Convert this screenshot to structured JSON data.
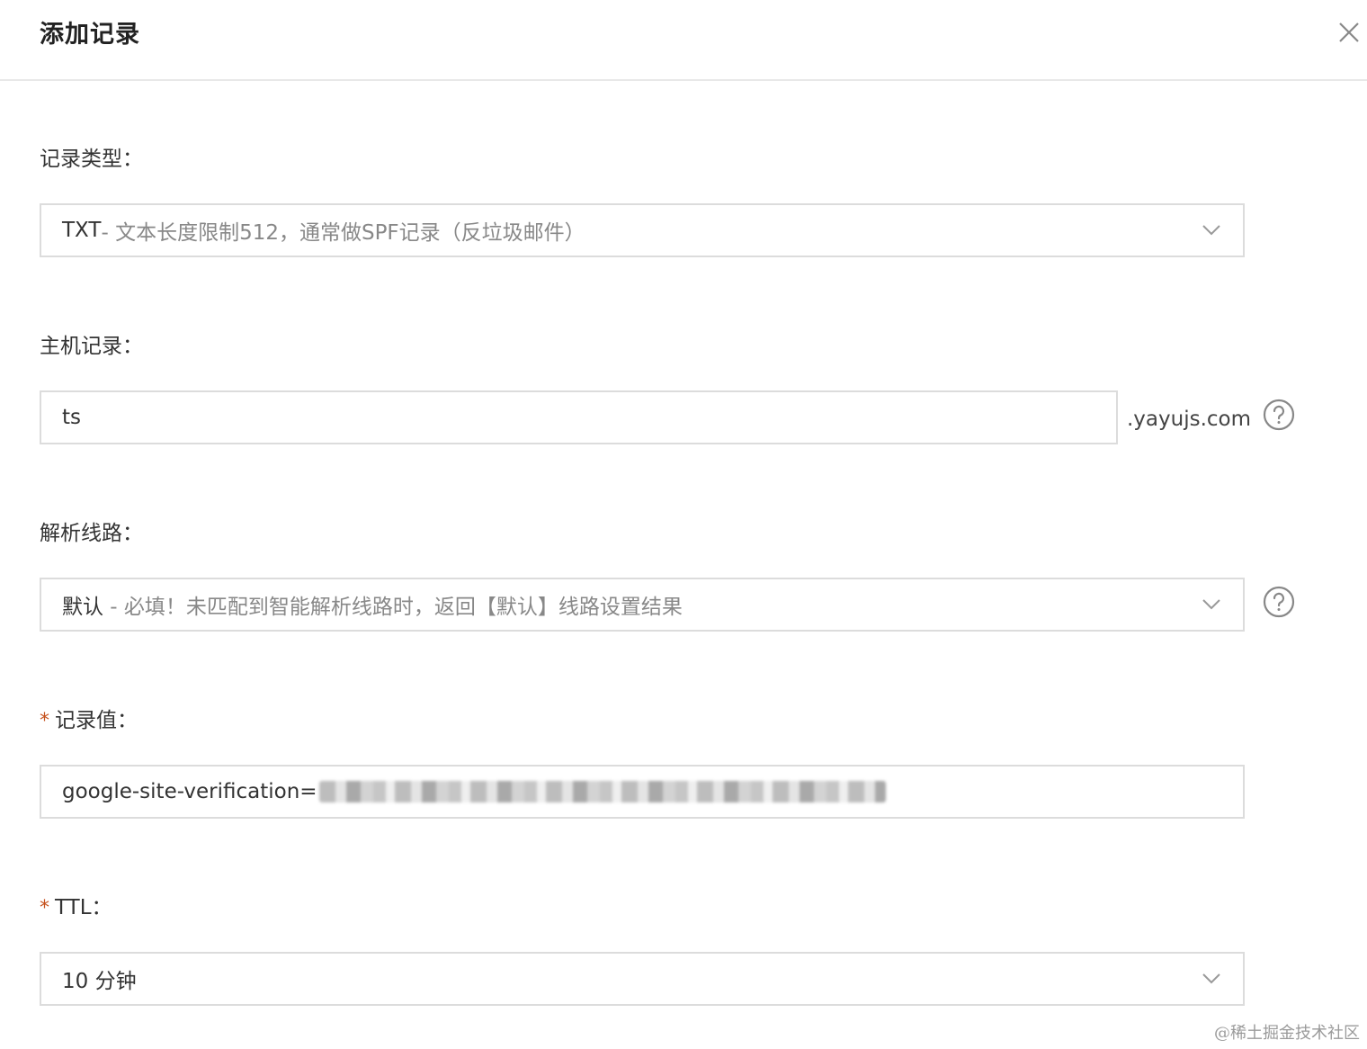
{
  "dialog": {
    "title": "添加记录",
    "close_icon": "close-icon"
  },
  "fields": {
    "record_type": {
      "label": "记录类型：",
      "value_main": "TXT",
      "value_sub": "- 文本长度限制512，通常做SPF记录（反垃圾邮件）"
    },
    "host_record": {
      "label": "主机记录：",
      "value": "ts",
      "suffix": ".yayujs.com"
    },
    "resolve_line": {
      "label": "解析线路：",
      "value_main": "默认",
      "value_sub": " - 必填！未匹配到智能解析线路时，返回【默认】线路设置结果"
    },
    "record_value": {
      "required_mark": "*",
      "label": "记录值：",
      "value": "google-site-verification="
    },
    "ttl": {
      "required_mark": "*",
      "label": "TTL：",
      "value": "10 分钟"
    }
  },
  "watermark": "@稀土掘金技术社区",
  "icons": [
    "close-icon",
    "chevron-down-icon",
    "question-circle-icon"
  ],
  "colors": {
    "required": "#c5511d",
    "border": "#dcdcdc",
    "muted_text": "#888888"
  }
}
